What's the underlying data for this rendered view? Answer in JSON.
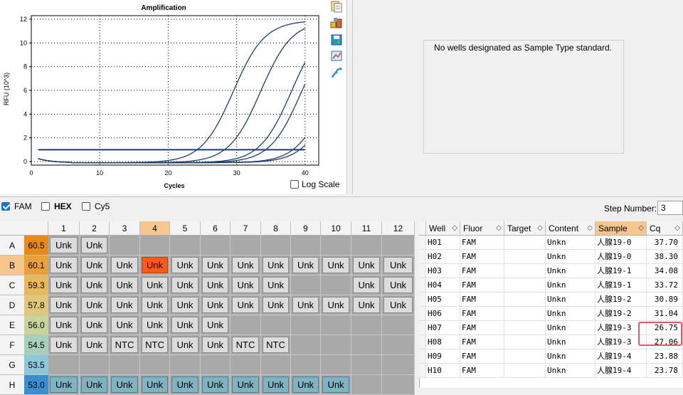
{
  "chart": {
    "title": "Amplification",
    "ylabel": "RFU (10^3)",
    "xlabel": "Cycles",
    "log_scale_label": "Log Scale",
    "line_color": "#1c3f6e"
  },
  "chart_data": {
    "type": "line",
    "title": "Amplification",
    "xlabel": "Cycles",
    "ylabel": "RFU (10^3)",
    "xlim": [
      0,
      42
    ],
    "ylim": [
      -0.3,
      12.3
    ],
    "x_ticks": [
      0,
      10,
      20,
      30,
      40
    ],
    "y_ticks": [
      0,
      2,
      4,
      6,
      8,
      10,
      12
    ],
    "grid": true,
    "threshold": 1.0,
    "curve_midpoints": [
      29.5,
      33.5,
      38.0,
      39.5,
      43.5,
      44.5
    ],
    "curve_plateau": 12.0,
    "x": [
      1,
      40
    ]
  },
  "side_toolbar": {
    "icons": [
      "copy-icon",
      "export-icon",
      "save-icon",
      "chart-settings-icon",
      "curve-icon"
    ]
  },
  "standard_panel": {
    "message": "No wells designated as Sample Type standard."
  },
  "fluor_bar": {
    "items": [
      {
        "label": "FAM",
        "checked": true,
        "bold": false
      },
      {
        "label": "HEX",
        "checked": false,
        "bold": true
      },
      {
        "label": "Cy5",
        "checked": false,
        "bold": false
      }
    ],
    "step_label": "Step Number:",
    "step_value": "3"
  },
  "plate": {
    "columns": [
      "1",
      "2",
      "3",
      "4",
      "5",
      "6",
      "7",
      "8",
      "9",
      "10",
      "11",
      "12"
    ],
    "selected_column": "4",
    "selected_row": "B",
    "rows": [
      {
        "label": "A",
        "temp": "60.5",
        "temp_color": "#e88a1a",
        "wells": [
          "Unk",
          "Unk",
          "",
          "",
          "",
          "",
          "",
          "",
          "",
          "",
          "",
          ""
        ]
      },
      {
        "label": "B",
        "temp": "60.1",
        "temp_color": "#e8a03a",
        "wells": [
          "Unk",
          "Unk",
          "Unk",
          "Unk",
          "Unk",
          "Unk",
          "Unk",
          "Unk",
          "Unk",
          "Unk",
          "Unk",
          "Unk"
        ]
      },
      {
        "label": "C",
        "temp": "59.3",
        "temp_color": "#e8b85a",
        "wells": [
          "Unk",
          "Unk",
          "Unk",
          "Unk",
          "Unk",
          "Unk",
          "Unk",
          "Unk",
          "",
          "",
          "Unk",
          "Unk"
        ]
      },
      {
        "label": "D",
        "temp": "57.8",
        "temp_color": "#e0c878",
        "wells": [
          "Unk",
          "Unk",
          "Unk",
          "Unk",
          "Unk",
          "Unk",
          "Unk",
          "Unk",
          "Unk",
          "Unk",
          "Unk",
          "Unk"
        ]
      },
      {
        "label": "E",
        "temp": "56.0",
        "temp_color": "#c8d49a",
        "wells": [
          "Unk",
          "Unk",
          "Unk",
          "Unk",
          "Unk",
          "Unk",
          "",
          "",
          "",
          "",
          "",
          ""
        ]
      },
      {
        "label": "F",
        "temp": "54.5",
        "temp_color": "#a8d0b8",
        "wells": [
          "Unk",
          "Unk",
          "NTC",
          "NTC",
          "Unk",
          "Unk",
          "NTC",
          "NTC",
          "",
          "",
          "",
          ""
        ]
      },
      {
        "label": "G",
        "temp": "53.5",
        "temp_color": "#8cc8d8",
        "wells": [
          "",
          "",
          "",
          "",
          "",
          "",
          "",
          "",
          "",
          "",
          "",
          ""
        ]
      },
      {
        "label": "H",
        "temp": "53.0",
        "temp_color": "#3a8fd0",
        "wells": [
          "Unk",
          "Unk",
          "Unk",
          "Unk",
          "Unk",
          "Unk",
          "Unk",
          "Unk",
          "Unk",
          "Unk",
          "",
          ""
        ]
      }
    ]
  },
  "results_table": {
    "headers": [
      "Well",
      "Fluor",
      "Target",
      "Content",
      "Sample",
      "Cq"
    ],
    "rows": [
      [
        "H01",
        "FAM",
        "",
        "Unkn",
        "人腺19-0",
        "37.70"
      ],
      [
        "H02",
        "FAM",
        "",
        "Unkn",
        "人腺19-0",
        "38.30"
      ],
      [
        "H03",
        "FAM",
        "",
        "Unkn",
        "人腺19-1",
        "34.08"
      ],
      [
        "H04",
        "FAM",
        "",
        "Unkn",
        "人腺19-1",
        "33.72"
      ],
      [
        "H05",
        "FAM",
        "",
        "Unkn",
        "人腺19-2",
        "30.89"
      ],
      [
        "H06",
        "FAM",
        "",
        "Unkn",
        "人腺19-2",
        "31.04"
      ],
      [
        "H07",
        "FAM",
        "",
        "Unkn",
        "人腺19-3",
        "26.75"
      ],
      [
        "H08",
        "FAM",
        "",
        "Unkn",
        "人腺19-3",
        "27.06"
      ],
      [
        "H09",
        "FAM",
        "",
        "Unkn",
        "人腺19-4",
        "23.88"
      ],
      [
        "H10",
        "FAM",
        "",
        "Unkn",
        "人腺19-4",
        "23.78"
      ]
    ]
  }
}
